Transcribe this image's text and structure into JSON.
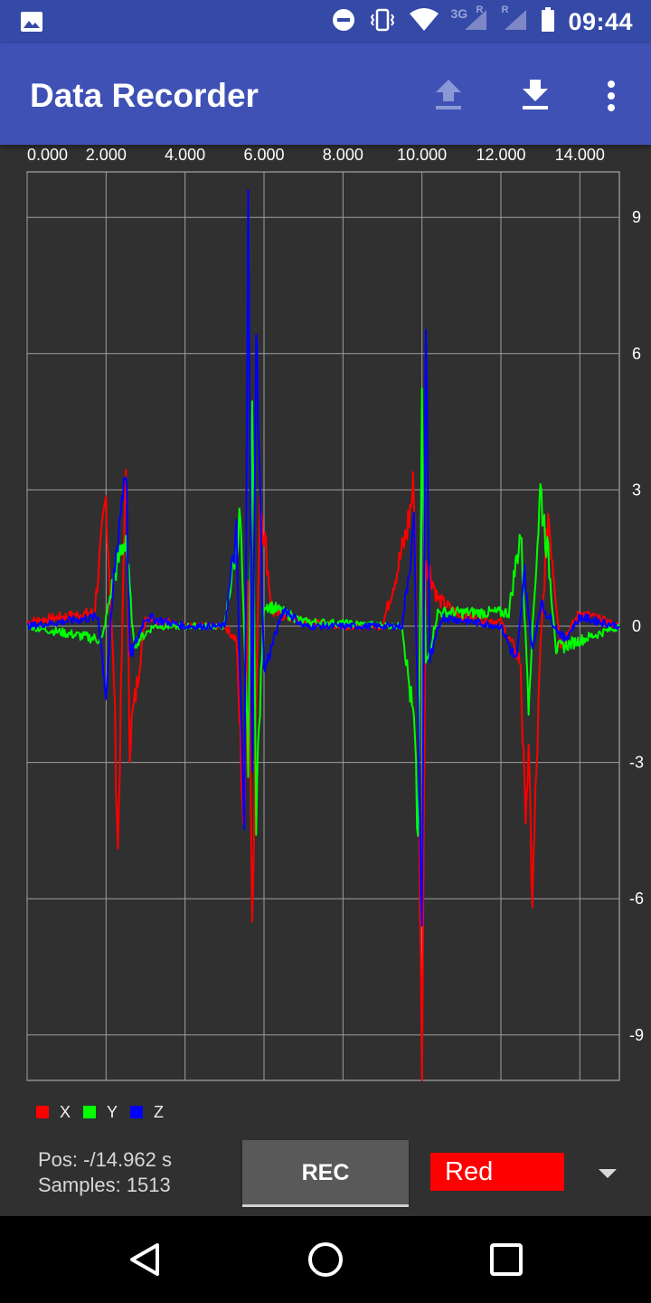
{
  "status_bar": {
    "time": "09:44",
    "network": "3G",
    "roaming_mark": "R",
    "icons": [
      "image-icon",
      "do-not-disturb-icon",
      "vibrate-icon",
      "wifi-icon",
      "signal-icon",
      "signal-icon",
      "battery-icon"
    ]
  },
  "app_bar": {
    "title": "Data Recorder",
    "actions": [
      "upload-icon",
      "download-icon",
      "overflow-menu-icon"
    ]
  },
  "chart_data": {
    "type": "line",
    "x_ticks": [
      "0.000",
      "2.000",
      "4.000",
      "6.000",
      "8.000",
      "10.000",
      "12.000",
      "14.000"
    ],
    "y_ticks": [
      "9",
      "6",
      "3",
      "0",
      "-3",
      "-6",
      "-9"
    ],
    "xlim": [
      0,
      15
    ],
    "ylim": [
      -10,
      10
    ],
    "grid": true,
    "legend_position": "bottom-left",
    "series": [
      {
        "name": "X",
        "color": "#ff0000",
        "values": [
          [
            0,
            0.1
          ],
          [
            1.7,
            0.3
          ],
          [
            2.0,
            2.8
          ],
          [
            2.2,
            -1.2
          ],
          [
            2.3,
            -5.0
          ],
          [
            2.5,
            3.9
          ],
          [
            2.6,
            -2.5
          ],
          [
            3.0,
            0.2
          ],
          [
            4.0,
            0
          ],
          [
            5.0,
            0
          ],
          [
            5.3,
            -0.3
          ],
          [
            5.5,
            -4.8
          ],
          [
            5.6,
            1.0
          ],
          [
            5.7,
            -6.3
          ],
          [
            5.9,
            3.0
          ],
          [
            6.2,
            0.3
          ],
          [
            7.0,
            0.1
          ],
          [
            8.0,
            0
          ],
          [
            9.0,
            0
          ],
          [
            9.6,
            2.0
          ],
          [
            9.8,
            3.1
          ],
          [
            9.9,
            -2.0
          ],
          [
            10.0,
            -10.0
          ],
          [
            10.1,
            1.5
          ],
          [
            10.4,
            0.6
          ],
          [
            11.0,
            0.2
          ],
          [
            12.0,
            0.1
          ],
          [
            12.5,
            -0.8
          ],
          [
            12.6,
            -4.0
          ],
          [
            12.7,
            -3.0
          ],
          [
            12.8,
            -6.0
          ],
          [
            13.0,
            -0.5
          ],
          [
            13.2,
            2.5
          ],
          [
            13.5,
            -0.4
          ],
          [
            14.0,
            0.3
          ],
          [
            15.0,
            0
          ]
        ]
      },
      {
        "name": "Y",
        "color": "#00ff00",
        "values": [
          [
            0,
            0
          ],
          [
            1.9,
            -0.3
          ],
          [
            2.2,
            1.1
          ],
          [
            2.5,
            2.0
          ],
          [
            2.7,
            -0.4
          ],
          [
            3.2,
            0
          ],
          [
            5.0,
            0
          ],
          [
            5.4,
            2.4
          ],
          [
            5.6,
            -3.0
          ],
          [
            5.7,
            5.0
          ],
          [
            5.8,
            -4.0
          ],
          [
            6.0,
            0.5
          ],
          [
            7.0,
            0.1
          ],
          [
            9.5,
            0
          ],
          [
            9.8,
            -2.2
          ],
          [
            9.9,
            -4.8
          ],
          [
            10.0,
            4.7
          ],
          [
            10.1,
            -0.9
          ],
          [
            10.4,
            0.3
          ],
          [
            12.2,
            0.3
          ],
          [
            12.5,
            2.1
          ],
          [
            12.7,
            -1.6
          ],
          [
            13.0,
            3.0
          ],
          [
            13.2,
            1.5
          ],
          [
            13.4,
            -0.5
          ],
          [
            15.0,
            0
          ]
        ]
      },
      {
        "name": "Z",
        "color": "#0000ff",
        "values": [
          [
            0,
            0
          ],
          [
            1.8,
            0.2
          ],
          [
            2.0,
            -1.5
          ],
          [
            2.2,
            1.1
          ],
          [
            2.5,
            3.7
          ],
          [
            2.6,
            -0.7
          ],
          [
            3.0,
            0.2
          ],
          [
            4.0,
            0
          ],
          [
            5.0,
            0
          ],
          [
            5.3,
            2.0
          ],
          [
            5.5,
            -4.8
          ],
          [
            5.6,
            10.0
          ],
          [
            5.7,
            -3.4
          ],
          [
            5.8,
            6.8
          ],
          [
            6.0,
            -1.0
          ],
          [
            6.5,
            0.4
          ],
          [
            7.0,
            0
          ],
          [
            8.0,
            0
          ],
          [
            9.5,
            0
          ],
          [
            9.8,
            2.2
          ],
          [
            9.9,
            -2.0
          ],
          [
            10.0,
            -6.9
          ],
          [
            10.1,
            6.9
          ],
          [
            10.2,
            -0.8
          ],
          [
            10.5,
            0.2
          ],
          [
            12.0,
            0
          ],
          [
            12.4,
            -0.8
          ],
          [
            12.6,
            1.2
          ],
          [
            12.8,
            -0.6
          ],
          [
            13.0,
            0.5
          ],
          [
            13.6,
            -0.3
          ],
          [
            14.0,
            0.2
          ],
          [
            15.0,
            0
          ]
        ]
      }
    ]
  },
  "legend": [
    {
      "label": "X",
      "color": "#ff0000"
    },
    {
      "label": "Y",
      "color": "#00ff00"
    },
    {
      "label": "Z",
      "color": "#0000ff"
    }
  ],
  "info": {
    "pos": "Pos: -/14.962 s",
    "samples": "Samples: 1513"
  },
  "controls": {
    "rec_label": "REC",
    "color_value": "Red"
  },
  "nav_bar": {
    "icons": [
      "back-icon",
      "home-icon",
      "recents-icon"
    ]
  }
}
